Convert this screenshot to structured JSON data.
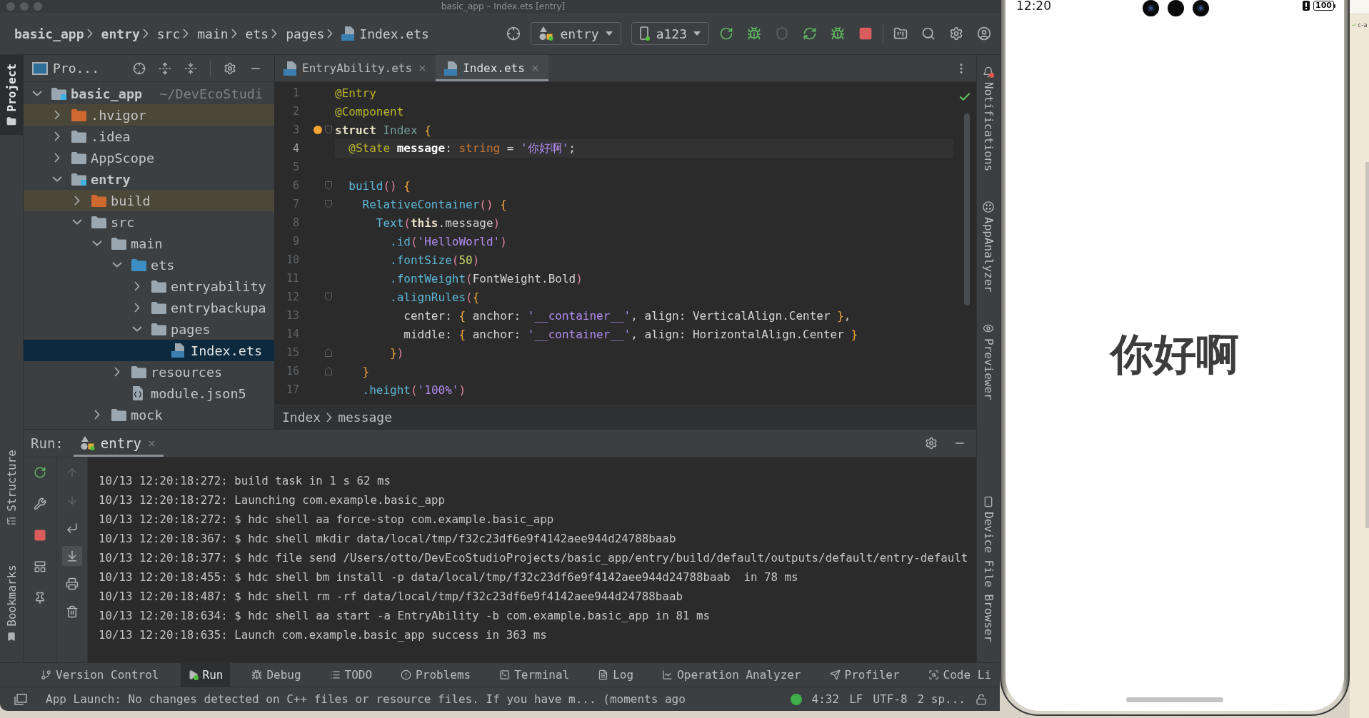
{
  "window": {
    "title": "basic_app – Index.ets [entry]"
  },
  "navigation_bar": {
    "breadcrumbs": [
      {
        "label": "basic_app",
        "kind": "module"
      },
      {
        "label": "entry",
        "kind": "module"
      },
      {
        "label": "src",
        "kind": "folder"
      },
      {
        "label": "main",
        "kind": "folder"
      },
      {
        "label": "ets",
        "kind": "folder"
      },
      {
        "label": "pages",
        "kind": "folder"
      },
      {
        "label": "Index.ets",
        "kind": "file"
      }
    ],
    "run_configuration": {
      "label": "entry",
      "running": true
    },
    "device": {
      "label": "a123",
      "connected": true
    },
    "actions": [
      {
        "kind": "run",
        "disabled": false
      },
      {
        "kind": "debug",
        "disabled": false
      },
      {
        "kind": "attach",
        "disabled": true
      },
      {
        "kind": "reload",
        "disabled": false
      },
      {
        "kind": "debug_attach",
        "disabled": false
      },
      {
        "kind": "stop",
        "disabled": false
      }
    ]
  },
  "left_stripe": {
    "top": [
      {
        "label": "Project",
        "selected": true
      }
    ],
    "bottom": [
      {
        "label": "Structure",
        "selected": false
      },
      {
        "label": "Bookmarks",
        "selected": false
      }
    ]
  },
  "project_panel": {
    "title": "Pro...",
    "tree": [
      {
        "label": "basic_app",
        "kind": "module",
        "path": "~/DevEcoStudi",
        "expanded": true,
        "selected": false,
        "children": [
          {
            "label": ".hvigor",
            "kind": "excluded",
            "expanded": false,
            "selected": false
          },
          {
            "label": ".idea",
            "kind": "folder",
            "expanded": false,
            "selected": false
          },
          {
            "label": "AppScope",
            "kind": "folder",
            "expanded": false,
            "selected": false
          },
          {
            "label": "entry",
            "kind": "module",
            "expanded": true,
            "selected": false,
            "children": [
              {
                "label": "build",
                "kind": "excluded",
                "expanded": false,
                "selected": false
              },
              {
                "label": "src",
                "kind": "folder",
                "expanded": true,
                "selected": false,
                "children": [
                  {
                    "label": "main",
                    "kind": "folder",
                    "expanded": true,
                    "selected": false,
                    "children": [
                      {
                        "label": "ets",
                        "kind": "source",
                        "expanded": true,
                        "selected": false,
                        "children": [
                          {
                            "label": "entryability",
                            "kind": "folder",
                            "expanded": false,
                            "selected": false
                          },
                          {
                            "label": "entrybackupa",
                            "kind": "folder",
                            "expanded": false,
                            "selected": false
                          },
                          {
                            "label": "pages",
                            "kind": "folder",
                            "expanded": true,
                            "selected": false,
                            "children": [
                              {
                                "label": "Index.ets",
                                "kind": "ets_file",
                                "selected": true
                              }
                            ]
                          }
                        ]
                      },
                      {
                        "label": "resources",
                        "kind": "folder",
                        "expanded": false,
                        "selected": false
                      },
                      {
                        "label": "module.json5",
                        "kind": "json_file",
                        "selected": false
                      }
                    ]
                  },
                  {
                    "label": "mock",
                    "kind": "folder",
                    "expanded": false,
                    "selected": false
                  }
                ]
              }
            ]
          }
        ]
      }
    ]
  },
  "editor": {
    "tabs": [
      {
        "label": "EntryAbility.ets",
        "selected": false
      },
      {
        "label": "Index.ets",
        "selected": true
      }
    ],
    "lines": [
      {
        "number": "1",
        "current": false,
        "bulb": false,
        "fold_start": false,
        "fold_end": false,
        "tokens": [
          {
            "kind": "decorator",
            "text": "@Entry"
          }
        ]
      },
      {
        "number": "2",
        "current": false,
        "bulb": false,
        "fold_start": false,
        "fold_end": false,
        "tokens": [
          {
            "kind": "decorator",
            "text": "@Component"
          }
        ]
      },
      {
        "number": "3",
        "current": false,
        "bulb": true,
        "fold_start": true,
        "fold_end": false,
        "tokens": [
          {
            "kind": "keyword",
            "text": "struct"
          },
          {
            "kind": "class",
            "text": " Index"
          },
          {
            "kind": "brace",
            "text": " {"
          }
        ]
      },
      {
        "number": "4",
        "current": true,
        "bulb": false,
        "fold_start": false,
        "fold_end": false,
        "tokens": [
          {
            "kind": "decorator",
            "text": "  @State"
          },
          {
            "kind": "field",
            "text": " message"
          },
          {
            "kind": "plain",
            "text": ": "
          },
          {
            "kind": "type",
            "text": "string"
          },
          {
            "kind": "plain",
            "text": " = "
          },
          {
            "kind": "string",
            "text": "'你好啊'"
          },
          {
            "kind": "plain",
            "text": ";"
          }
        ]
      },
      {
        "number": "5",
        "current": false,
        "bulb": false,
        "fold_start": false,
        "fold_end": false
      },
      {
        "number": "6",
        "current": false,
        "bulb": false,
        "fold_start": true,
        "fold_end": false,
        "tokens": [
          {
            "kind": "function",
            "text": "  build"
          },
          {
            "kind": "paren",
            "text": "()"
          },
          {
            "kind": "brace",
            "text": " {"
          }
        ]
      },
      {
        "number": "7",
        "current": false,
        "bulb": false,
        "fold_start": true,
        "fold_end": false,
        "tokens": [
          {
            "kind": "function",
            "text": "    RelativeContainer"
          },
          {
            "kind": "paren",
            "text": "()"
          },
          {
            "kind": "brace",
            "text": " {"
          }
        ]
      },
      {
        "number": "8",
        "current": false,
        "bulb": false,
        "fold_start": false,
        "fold_end": false,
        "tokens": [
          {
            "kind": "function",
            "text": "      Text"
          },
          {
            "kind": "paren",
            "text": "("
          },
          {
            "kind": "keyword",
            "text": "this"
          },
          {
            "kind": "plain",
            "text": ".message"
          },
          {
            "kind": "paren",
            "text": ")"
          }
        ]
      },
      {
        "number": "9",
        "current": false,
        "bulb": false,
        "fold_start": false,
        "fold_end": false,
        "tokens": [
          {
            "kind": "function",
            "text": "        .id"
          },
          {
            "kind": "paren",
            "text": "("
          },
          {
            "kind": "string",
            "text": "'HelloWorld'"
          },
          {
            "kind": "paren",
            "text": ")"
          }
        ]
      },
      {
        "number": "10",
        "current": false,
        "bulb": false,
        "fold_start": false,
        "fold_end": false,
        "tokens": [
          {
            "kind": "function",
            "text": "        .fontSize"
          },
          {
            "kind": "paren",
            "text": "("
          },
          {
            "kind": "number",
            "text": "50"
          },
          {
            "kind": "paren",
            "text": ")"
          }
        ]
      },
      {
        "number": "11",
        "current": false,
        "bulb": false,
        "fold_start": false,
        "fold_end": false,
        "tokens": [
          {
            "kind": "function",
            "text": "        .fontWeight"
          },
          {
            "kind": "paren",
            "text": "("
          },
          {
            "kind": "plain",
            "text": "FontWeight.Bold"
          },
          {
            "kind": "paren",
            "text": ")"
          }
        ]
      },
      {
        "number": "12",
        "current": false,
        "bulb": false,
        "fold_start": true,
        "fold_end": false,
        "tokens": [
          {
            "kind": "function",
            "text": "        .alignRules"
          },
          {
            "kind": "paren",
            "text": "("
          },
          {
            "kind": "brace",
            "text": "{"
          }
        ]
      },
      {
        "number": "13",
        "current": false,
        "bulb": false,
        "fold_start": false,
        "fold_end": false,
        "tokens": [
          {
            "kind": "plain",
            "text": "          center: "
          },
          {
            "kind": "brace",
            "text": "{"
          },
          {
            "kind": "plain",
            "text": " anchor: "
          },
          {
            "kind": "string",
            "text": "'__container__'"
          },
          {
            "kind": "plain",
            "text": ", align: VerticalAlign.Center "
          },
          {
            "kind": "brace",
            "text": "}"
          },
          {
            "kind": "plain",
            "text": ","
          }
        ]
      },
      {
        "number": "14",
        "current": false,
        "bulb": false,
        "fold_start": false,
        "fold_end": false,
        "tokens": [
          {
            "kind": "plain",
            "text": "          middle: "
          },
          {
            "kind": "brace",
            "text": "{"
          },
          {
            "kind": "plain",
            "text": " anchor: "
          },
          {
            "kind": "string",
            "text": "'__container__'"
          },
          {
            "kind": "plain",
            "text": ", align: HorizontalAlign.Center "
          },
          {
            "kind": "brace",
            "text": "}"
          }
        ]
      },
      {
        "number": "15",
        "current": false,
        "bulb": false,
        "fold_start": false,
        "fold_end": true,
        "tokens": [
          {
            "kind": "brace",
            "text": "        }"
          },
          {
            "kind": "paren",
            "text": ")"
          }
        ]
      },
      {
        "number": "16",
        "current": false,
        "bulb": false,
        "fold_start": false,
        "fold_end": true,
        "tokens": [
          {
            "kind": "brace",
            "text": "    }"
          }
        ]
      },
      {
        "number": "17",
        "current": false,
        "bulb": false,
        "fold_start": false,
        "fold_end": false,
        "tokens": [
          {
            "kind": "function",
            "text": "    .height"
          },
          {
            "kind": "paren",
            "text": "("
          },
          {
            "kind": "string",
            "text": "'100%'"
          },
          {
            "kind": "paren",
            "text": ")"
          }
        ]
      }
    ],
    "breadcrumbs": [
      "Index",
      "message"
    ]
  },
  "right_stripe": {
    "top": [
      {
        "label": "Notifications",
        "unread": true
      },
      {
        "label": "AppAnalyzer",
        "unread": false
      },
      {
        "label": "Previewer",
        "unread": false
      }
    ],
    "bottom": [
      {
        "label": "Device File Browser",
        "unread": false
      }
    ]
  },
  "run_panel": {
    "label": "Run:",
    "tabs": [
      {
        "label": "entry",
        "selected": true,
        "running": true
      }
    ],
    "tools": [
      {
        "kind": "previous",
        "disabled": true,
        "on": false
      },
      {
        "kind": "next",
        "disabled": true,
        "on": false
      },
      {
        "kind": "soft_wrap",
        "disabled": false,
        "on": false
      },
      {
        "kind": "scroll_to_end",
        "disabled": false,
        "on": true
      },
      {
        "kind": "print",
        "disabled": false,
        "on": false
      },
      {
        "kind": "clear",
        "disabled": false,
        "on": false
      }
    ],
    "console": [
      "10/13 12:20:18:272: build task in 1 s 62 ms",
      "10/13 12:20:18:272: Launching com.example.basic_app",
      "10/13 12:20:18:272: $ hdc shell aa force-stop com.example.basic_app",
      "10/13 12:20:18:367: $ hdc shell mkdir data/local/tmp/f32c23df6e9f4142aee944d24788baab",
      "10/13 12:20:18:377: $ hdc file send /Users/otto/DevEcoStudioProjects/basic_app/entry/build/default/outputs/default/entry-default",
      "10/13 12:20:18:455: $ hdc shell bm install -p data/local/tmp/f32c23df6e9f4142aee944d24788baab  in 78 ms",
      "10/13 12:20:18:487: $ hdc shell rm -rf data/local/tmp/f32c23df6e9f4142aee944d24788baab",
      "10/13 12:20:18:634: $ hdc shell aa start -a EntryAbility -b com.example.basic_app in 81 ms",
      "10/13 12:20:18:635: Launch com.example.basic_app success in 363 ms"
    ]
  },
  "tool_window_bar": [
    {
      "label": "Version Control",
      "selected": false,
      "running": false
    },
    {
      "label": "Run",
      "selected": true,
      "running": true
    },
    {
      "label": "Debug",
      "selected": false,
      "running": false
    },
    {
      "label": "TODO",
      "selected": false,
      "running": false
    },
    {
      "label": "Problems",
      "selected": false,
      "running": false
    },
    {
      "label": "Terminal",
      "selected": false,
      "running": false
    },
    {
      "label": "Log",
      "selected": false,
      "running": false
    },
    {
      "label": "Operation Analyzer",
      "selected": false,
      "running": false
    },
    {
      "label": "Profiler",
      "selected": false,
      "running": false
    },
    {
      "label": "Code Li",
      "selected": false,
      "running": false
    }
  ],
  "status_bar": {
    "message": "App Launch: No changes detected on C++ files or resource files. If you have m... (moments ago",
    "position": "4:32",
    "line_separator": "LF",
    "encoding": "UTF-8",
    "indent": "2 sp...",
    "read_only": false
  },
  "phone_preview": {
    "time": "12:20",
    "battery": "100",
    "message": "你好啊"
  },
  "desktop": {
    "label": "c-a"
  }
}
